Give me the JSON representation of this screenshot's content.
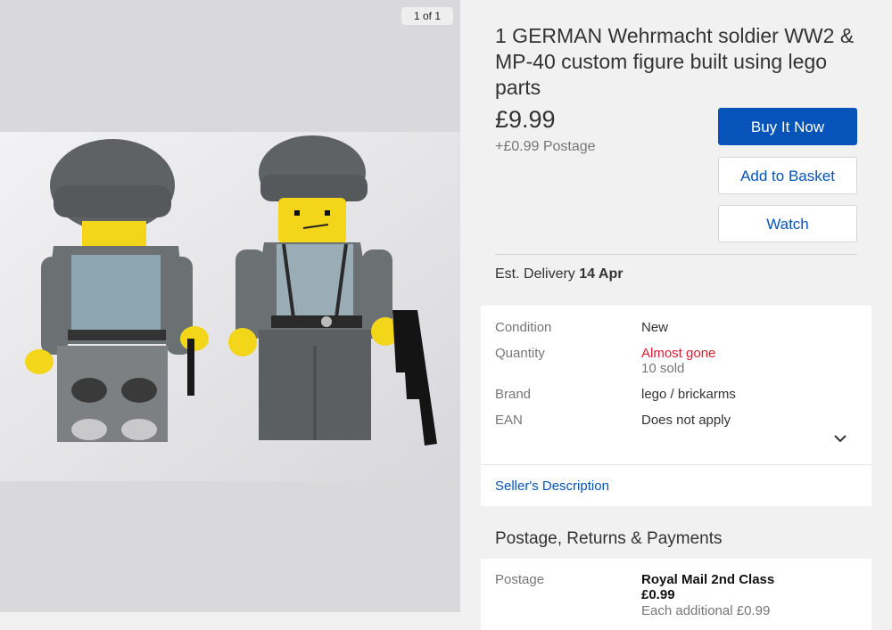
{
  "gallery": {
    "counter": "1 of 1",
    "image_alt": "LEGO soldier minifigures"
  },
  "listing": {
    "title": "1 GERMAN Wehrmacht soldier WW2 & MP-40 custom figure built using lego parts",
    "price": "£9.99",
    "postage": "+£0.99 Postage"
  },
  "actions": {
    "buy_now": "Buy It Now",
    "add_to_basket": "Add to Basket",
    "watch": "Watch"
  },
  "delivery": {
    "label": "Est. Delivery",
    "date": "14 Apr"
  },
  "details": {
    "rows": [
      {
        "label": "Condition",
        "value": "New"
      },
      {
        "label": "Quantity",
        "value": "Almost gone",
        "sub": "10 sold"
      },
      {
        "label": "Brand",
        "value": "lego / brickarms"
      },
      {
        "label": "EAN",
        "value": "Does not apply"
      }
    ],
    "seller_description": "Seller's Description"
  },
  "shipping": {
    "heading": "Postage, Returns & Payments",
    "label": "Postage",
    "service": "Royal Mail 2nd Class",
    "cost": "£0.99",
    "additional": "Each additional £0.99"
  },
  "colors": {
    "accent": "#0654ba",
    "alert": "#dd1e31"
  }
}
